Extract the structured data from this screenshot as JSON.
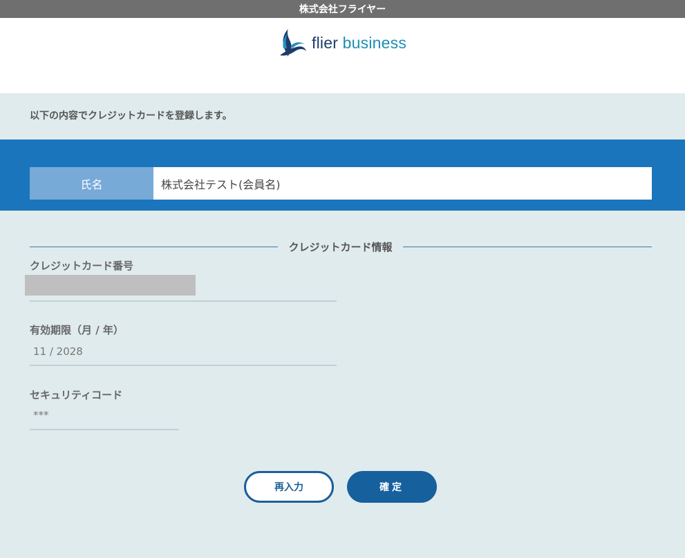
{
  "company_bar": {
    "title": "株式会社フライヤー"
  },
  "logo": {
    "word1": "flier",
    "word2": "business",
    "icon": "flier-wave-logo-icon"
  },
  "intro": {
    "text": "以下の内容でクレジットカードを登録します。"
  },
  "name_row": {
    "label": "氏名",
    "value": "株式会社テスト(会員名)"
  },
  "card_section": {
    "title": "クレジットカード情報",
    "card_number": {
      "label": "クレジットカード番号",
      "value": ""
    },
    "expiry": {
      "label": "有効期限（月 / 年）",
      "value": "11 / 2028"
    },
    "security_code": {
      "label": "セキュリティコード",
      "value": "***"
    }
  },
  "buttons": {
    "reenter": "再入力",
    "confirm": "確定"
  },
  "colors": {
    "band_blue": "#1b75bc",
    "label_blue": "#78aad8",
    "page_bg": "#e0ebed",
    "button_dark": "#17609e",
    "top_bar": "#6f6f6f"
  }
}
